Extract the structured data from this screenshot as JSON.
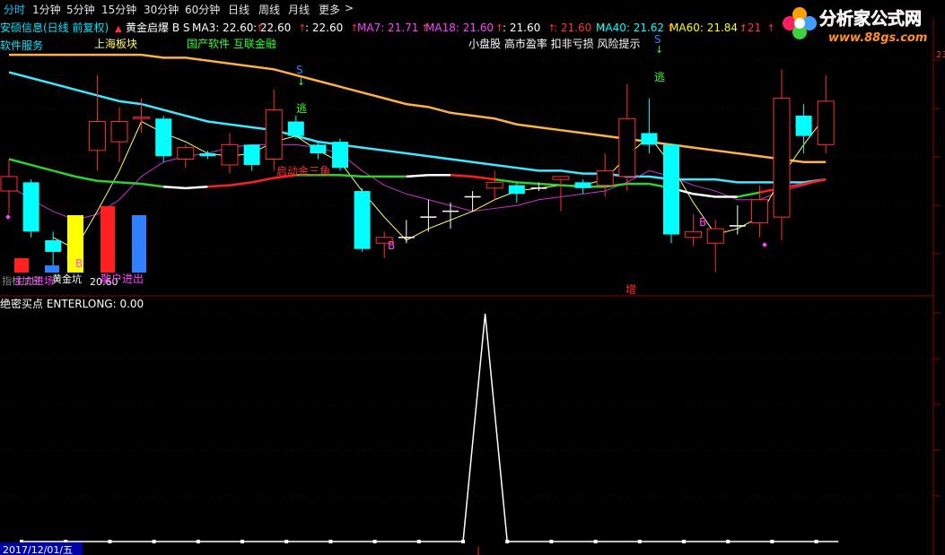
{
  "toolbar": {
    "items": [
      "分时",
      "1分钟",
      "5分钟",
      "15分钟",
      "30分钟",
      "60分钟",
      "日线",
      "周线",
      "月线",
      "更多"
    ],
    "more_arrow": ">"
  },
  "stock_header": {
    "title": "安硕信息(日线 前复权)",
    "indicator": "黄金启爆 B S",
    "ma": [
      {
        "label": "MA3: 22.60",
        "color": "#ffffff"
      },
      {
        "label": ": 22.60",
        "color": "#ffffff"
      },
      {
        "label": ": 22.60",
        "color": "#ffffff"
      },
      {
        "label": "MA7: 21.71",
        "color": "#ff44ff"
      },
      {
        "label": "MA18: 21.60",
        "color": "#ff44ff"
      },
      {
        "label": ": 21.60",
        "color": "#ffffff"
      },
      {
        "label": ": 21.60",
        "color": "#ff3030"
      },
      {
        "label": "MA40: 21.62",
        "color": "#00ffff"
      },
      {
        "label": "MA60: 21.84",
        "color": "#ffff00"
      },
      {
        "label": ": 21",
        "color": "#ff3030"
      }
    ]
  },
  "tags": {
    "software": "软件服务",
    "shanghai": "上海板块",
    "domestic": "国产软件 互联金融",
    "warning": "小盘股 高市盈率 扣非亏损 风险提示"
  },
  "candles": [
    {
      "o": 21.8,
      "c": 21.3,
      "h": 22.4,
      "l": 20.5,
      "color": "red"
    },
    {
      "o": 21.6,
      "c": 19.9,
      "h": 21.7,
      "l": 19.7,
      "color": "cyan"
    },
    {
      "o": 19.6,
      "c": 19.2,
      "h": 19.9,
      "l": 18.6,
      "color": "cyan"
    },
    {
      "o": 19.1,
      "c": 18.9,
      "h": 19.3,
      "l": 18.7,
      "color": "cyan"
    },
    {
      "o": 22.7,
      "c": 23.7,
      "h": 25.3,
      "l": 22.0,
      "color": "red"
    },
    {
      "o": 23.0,
      "c": 23.7,
      "h": 24.2,
      "l": 22.3,
      "color": "red"
    },
    {
      "o": 23.85,
      "c": 23.8,
      "h": 24.5,
      "l": 23.3,
      "color": "red"
    },
    {
      "o": 23.8,
      "c": 22.5,
      "h": 23.9,
      "l": 22.3,
      "color": "cyan"
    },
    {
      "o": 22.4,
      "c": 22.8,
      "h": 22.9,
      "l": 22.1,
      "color": "red"
    },
    {
      "o": 22.6,
      "c": 22.5,
      "h": 22.7,
      "l": 22.4,
      "color": "cyan"
    },
    {
      "o": 22.2,
      "c": 22.9,
      "h": 23.3,
      "l": 21.9,
      "color": "red"
    },
    {
      "o": 22.9,
      "c": 22.2,
      "h": 22.9,
      "l": 22.0,
      "color": "cyan"
    },
    {
      "o": 22.4,
      "c": 24.1,
      "h": 24.8,
      "l": 22.0,
      "color": "red"
    },
    {
      "o": 23.7,
      "c": 23.2,
      "h": 23.9,
      "l": 23.1,
      "color": "cyan"
    },
    {
      "o": 22.9,
      "c": 22.6,
      "h": 23.0,
      "l": 22.4,
      "color": "cyan"
    },
    {
      "o": 23.0,
      "c": 22.1,
      "h": 23.1,
      "l": 22.0,
      "color": "cyan"
    },
    {
      "o": 21.3,
      "c": 19.3,
      "h": 21.4,
      "l": 19.2,
      "color": "cyan"
    },
    {
      "o": 19.5,
      "c": 19.7,
      "h": 19.9,
      "l": 19.0,
      "color": "red"
    },
    {
      "o": 19.7,
      "c": 19.7,
      "h": 20.3,
      "l": 19.5,
      "color": "white"
    },
    {
      "o": 20.4,
      "c": 20.4,
      "h": 21.0,
      "l": 19.9,
      "color": "white"
    },
    {
      "o": 20.6,
      "c": 20.6,
      "h": 20.9,
      "l": 20.0,
      "color": "white"
    },
    {
      "o": 21.1,
      "c": 21.1,
      "h": 21.3,
      "l": 20.6,
      "color": "white"
    },
    {
      "o": 21.4,
      "c": 21.6,
      "h": 22.0,
      "l": 21.0,
      "color": "red"
    },
    {
      "o": 21.5,
      "c": 21.2,
      "h": 21.6,
      "l": 20.9,
      "color": "cyan"
    },
    {
      "o": 21.4,
      "c": 21.4,
      "h": 21.6,
      "l": 21.3,
      "color": "white"
    },
    {
      "o": 21.7,
      "c": 21.8,
      "h": 21.8,
      "l": 20.6,
      "color": "red"
    },
    {
      "o": 21.6,
      "c": 21.4,
      "h": 21.7,
      "l": 21.2,
      "color": "cyan"
    },
    {
      "o": 21.5,
      "c": 22.0,
      "h": 22.6,
      "l": 21.1,
      "color": "red"
    },
    {
      "o": 21.8,
      "c": 23.8,
      "h": 25.0,
      "l": 21.3,
      "color": "red"
    },
    {
      "o": 23.3,
      "c": 22.9,
      "h": 24.5,
      "l": 22.6,
      "color": "cyan"
    },
    {
      "o": 22.9,
      "c": 19.8,
      "h": 22.9,
      "l": 19.5,
      "color": "cyan"
    },
    {
      "o": 19.7,
      "c": 19.9,
      "h": 20.5,
      "l": 19.4,
      "color": "red"
    },
    {
      "o": 19.5,
      "c": 20.0,
      "h": 20.3,
      "l": 18.5,
      "color": "red"
    },
    {
      "o": 20.1,
      "c": 20.1,
      "h": 20.8,
      "l": 19.8,
      "color": "white"
    },
    {
      "o": 20.2,
      "c": 21.0,
      "h": 21.5,
      "l": 19.7,
      "color": "red"
    },
    {
      "o": 20.4,
      "c": 24.5,
      "h": 25.5,
      "l": 19.6,
      "color": "red"
    },
    {
      "o": 23.9,
      "c": 23.2,
      "h": 24.3,
      "l": 22.6,
      "color": "cyan"
    },
    {
      "o": 22.9,
      "c": 24.4,
      "h": 25.3,
      "l": 22.6,
      "color": "red"
    }
  ],
  "ma_lines": {
    "ma40": {
      "color": "#40e8ff",
      "values": [
        25.4,
        25.2,
        25.0,
        24.8,
        24.6,
        24.4,
        24.3,
        24.1,
        23.9,
        23.7,
        23.6,
        23.5,
        23.4,
        23.2,
        23.0,
        22.9,
        22.8,
        22.7,
        22.6,
        22.5,
        22.4,
        22.3,
        22.2,
        22.1,
        22.0,
        22.0,
        21.9,
        21.9,
        21.8,
        21.8,
        21.7,
        21.7,
        21.7,
        21.6,
        21.6,
        21.6,
        21.6,
        21.7
      ]
    },
    "ma60": {
      "color": "#ffb048",
      "values": [
        26.0,
        26.0,
        26.0,
        26.0,
        26.0,
        26.0,
        26.0,
        25.9,
        25.9,
        25.8,
        25.7,
        25.6,
        25.5,
        25.3,
        25.1,
        24.9,
        24.7,
        24.5,
        24.3,
        24.2,
        24.0,
        23.9,
        23.8,
        23.6,
        23.5,
        23.4,
        23.3,
        23.2,
        23.1,
        23.0,
        22.9,
        22.8,
        22.7,
        22.6,
        22.5,
        22.4,
        22.3,
        22.3
      ]
    },
    "ma18": {
      "color": "#30d030",
      "segments": "mixed",
      "values": [
        22.4,
        22.2,
        22.0,
        21.8,
        21.65,
        21.6,
        21.55,
        21.45,
        21.4,
        21.45,
        21.5,
        21.6,
        21.75,
        21.85,
        21.85,
        21.85,
        21.8,
        21.8,
        21.8,
        21.85,
        21.85,
        21.8,
        21.7,
        21.6,
        21.55,
        21.5,
        21.45,
        21.45,
        21.55,
        21.55,
        21.4,
        21.2,
        21.1,
        21.1,
        21.25,
        21.4,
        21.55,
        21.7
      ]
    },
    "ma7": {
      "color": "#d030d0",
      "values": [
        21.5,
        21.0,
        20.6,
        20.3,
        20.5,
        21.0,
        21.8,
        22.3,
        22.5,
        22.6,
        22.8,
        22.9,
        22.9,
        22.9,
        22.8,
        22.6,
        22.0,
        21.5,
        21.2,
        21.0,
        20.8,
        20.6,
        20.7,
        20.8,
        21.0,
        21.1,
        21.2,
        21.3,
        21.6,
        22.0,
        21.8,
        21.5,
        21.3,
        21.0,
        21.0,
        21.3,
        21.5,
        21.7
      ]
    },
    "ma3": {
      "color": "#ffff60",
      "values": [
        null,
        null,
        19.7,
        19.3,
        20.6,
        22.0,
        23.7,
        23.3,
        23.0,
        22.6,
        22.5,
        22.6,
        23.0,
        23.2,
        22.7,
        22.3,
        21.3,
        20.4,
        19.6,
        20.0,
        20.3,
        20.6,
        21.0,
        21.3,
        21.4,
        21.5,
        21.5,
        21.7,
        22.5,
        23.2,
        22.2,
        20.9,
        19.8,
        20.0,
        20.4,
        21.8,
        22.9,
        23.9
      ]
    }
  },
  "markers": {
    "s_label": "S",
    "escape_label": "逃",
    "b_label": "B",
    "qidong": "启动金三角",
    "increase": "增",
    "zhu": "主力进场",
    "huangjin": "黄金坑",
    "value_20": "20.60",
    "sanhu": "散户进出",
    "zhibiao": "指标加密"
  },
  "sub_panel": {
    "title": "绝密买点 ENTERLONG: 0.00",
    "values": [
      0,
      0,
      0,
      0,
      0,
      0,
      0,
      0,
      0,
      0,
      0,
      0,
      0,
      0,
      0,
      0,
      0,
      0,
      0,
      0,
      0,
      1,
      0,
      0,
      0,
      0,
      0,
      0,
      0,
      0,
      0,
      0,
      0,
      0,
      0,
      0,
      0,
      0
    ],
    "date_label": "2017/12/01/五"
  },
  "logo": {
    "name": "分析家公式网",
    "url": "www.88gs.com",
    "brand_colors": [
      "#ff2020",
      "#ffa000",
      "#40a0ff",
      "#40d040"
    ]
  },
  "right_axis": {
    "label": "23"
  }
}
